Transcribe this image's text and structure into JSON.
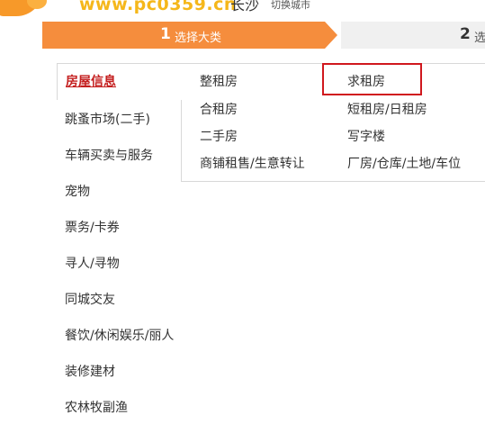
{
  "header": {
    "watermark": "www.pc0359.cn",
    "city": "长沙",
    "switch_city": "切换城市"
  },
  "steps": [
    {
      "num": "1",
      "label": "选择大类",
      "state": "active"
    },
    {
      "num": "2",
      "label": "选",
      "state": "pending"
    }
  ],
  "categories": [
    {
      "label": "房屋信息",
      "active": true
    },
    {
      "label": "跳蚤市场(二手)"
    },
    {
      "label": "车辆买卖与服务"
    },
    {
      "label": "宠物"
    },
    {
      "label": "票务/卡券"
    },
    {
      "label": "寻人/寻物"
    },
    {
      "label": "同城交友"
    },
    {
      "label": "餐饮/休闲娱乐/丽人"
    },
    {
      "label": "装修建材"
    },
    {
      "label": "农林牧副渔"
    }
  ],
  "subcategories": {
    "col1": [
      "整租房",
      "合租房",
      "二手房",
      "商铺租售/生意转让"
    ],
    "col2": [
      "求租房",
      "短租房/日租房",
      "写字楼",
      "厂房/仓库/土地/车位"
    ]
  },
  "highlighted": "求租房",
  "colors": {
    "step_active": "#f58d3d",
    "active_category": "#c41f1f",
    "highlight_border": "#d0181e"
  }
}
